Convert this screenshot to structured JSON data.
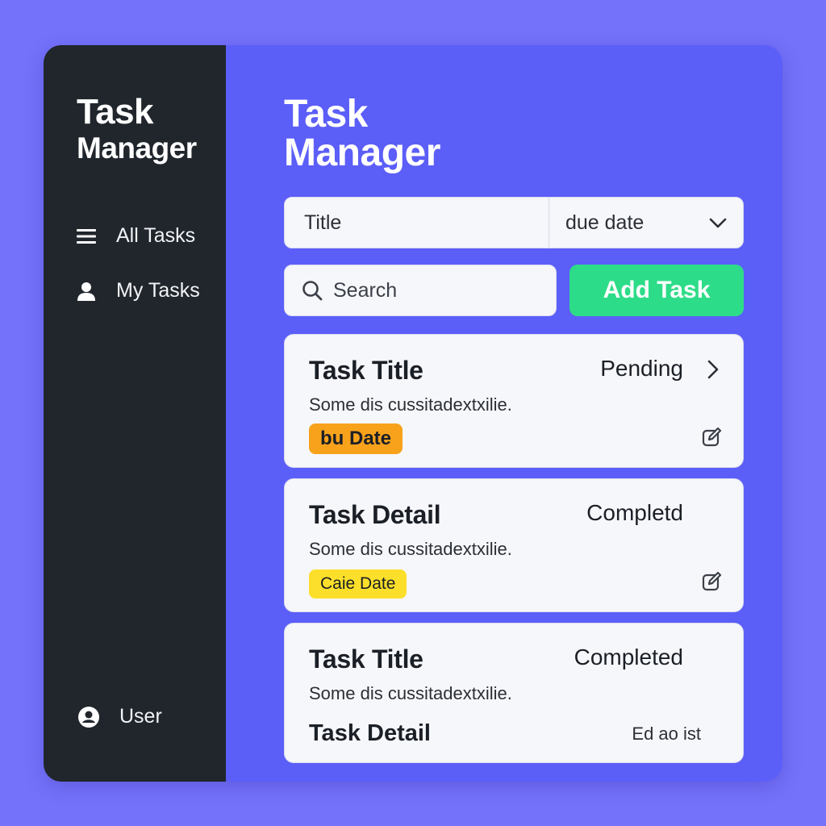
{
  "sidebar": {
    "title_line1": "Task",
    "title_line2": "Manager",
    "nav": [
      {
        "label": "All Tasks",
        "icon": "menu-icon"
      },
      {
        "label": "My Tasks",
        "icon": "user-icon"
      }
    ],
    "user": {
      "label": "User",
      "icon": "user-circle-icon"
    }
  },
  "main": {
    "title_line1": "Task",
    "title_line2": "Manager",
    "filter": {
      "title_placeholder": "Title",
      "due_select": "due date"
    },
    "search": {
      "placeholder": "Search"
    },
    "add_button": "Add Task",
    "tasks": [
      {
        "title": "Task Title",
        "status": "Pending",
        "description": "Some dis cussitadextxilie.",
        "tag": "bu Date"
      },
      {
        "title": "Task Detail",
        "status": "Completd",
        "description": "Some dis cussitadextxilie.",
        "tag": "Caie Date"
      },
      {
        "title": "Task Title",
        "status": "Completed",
        "description": "Some dis cussitadextxilie.",
        "subtitle": "Task Detail",
        "note": "Ed ao ist"
      }
    ]
  },
  "colors": {
    "page_bg": "#7472fb",
    "sidebar_bg": "#20262c",
    "main_bg": "#5c5ef8",
    "accent_green": "#2ddc88",
    "tag_orange": "#f8a21c",
    "tag_yellow": "#fcdf2a"
  }
}
